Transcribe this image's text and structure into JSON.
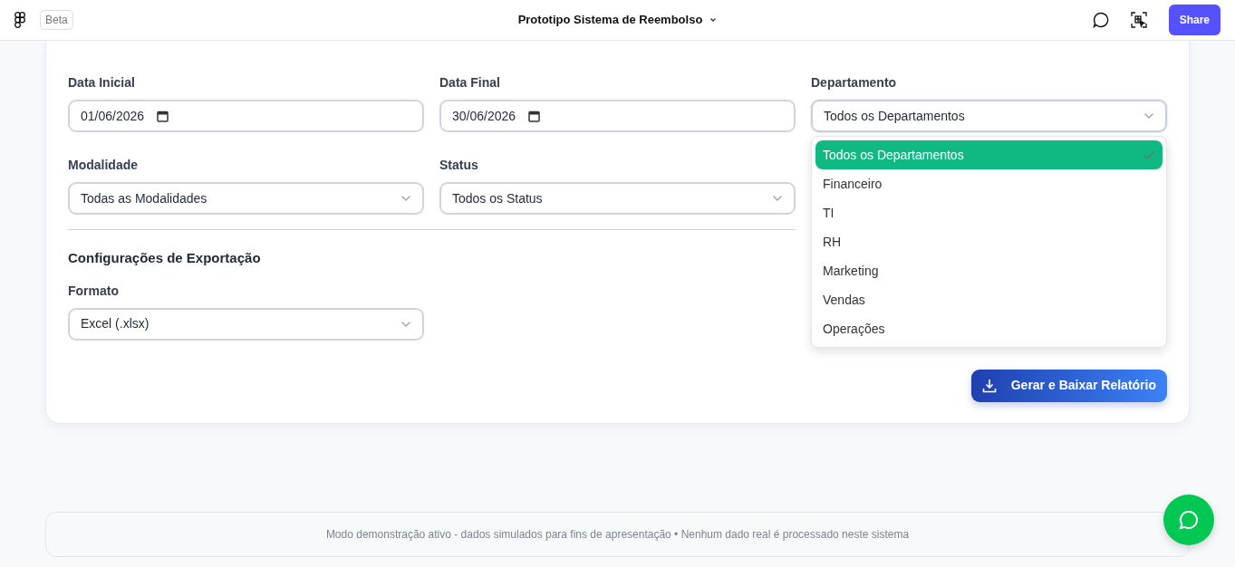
{
  "topbar": {
    "badge": "Beta",
    "title": "Prototipo Sistema de Reembolso",
    "share": "Share"
  },
  "filters": [
    {
      "kind": "date",
      "label": "Data Inicial",
      "value": "01/06/2026"
    },
    {
      "kind": "date",
      "label": "Data Final",
      "value": "30/06/2026"
    },
    {
      "kind": "select",
      "label": "Departamento",
      "value": "Todos os Departamentos",
      "expanded": true
    },
    {
      "kind": "select",
      "label": "Modalidade",
      "value": "Todas as Modalidades",
      "expanded": false
    },
    {
      "kind": "select",
      "label": "Status",
      "value": "Todos os Status",
      "expanded": false
    }
  ],
  "dropdown_options": [
    {
      "label": "Todos os Departamentos",
      "selected": true
    },
    {
      "label": "Financeiro",
      "selected": false
    },
    {
      "label": "TI",
      "selected": false
    },
    {
      "label": "RH",
      "selected": false
    },
    {
      "label": "Marketing",
      "selected": false
    },
    {
      "label": "Vendas",
      "selected": false
    },
    {
      "label": "Operações",
      "selected": false
    }
  ],
  "export": {
    "title": "Configurações de Exportação",
    "format_label": "Formato",
    "format_value": "Excel (.xlsx)"
  },
  "generate_button": "Gerar e Baixar Relatório",
  "footer": "Modo demonstração ativo - dados simulados para fins de apresentação • Nenhum dado real é processado neste sistema"
}
